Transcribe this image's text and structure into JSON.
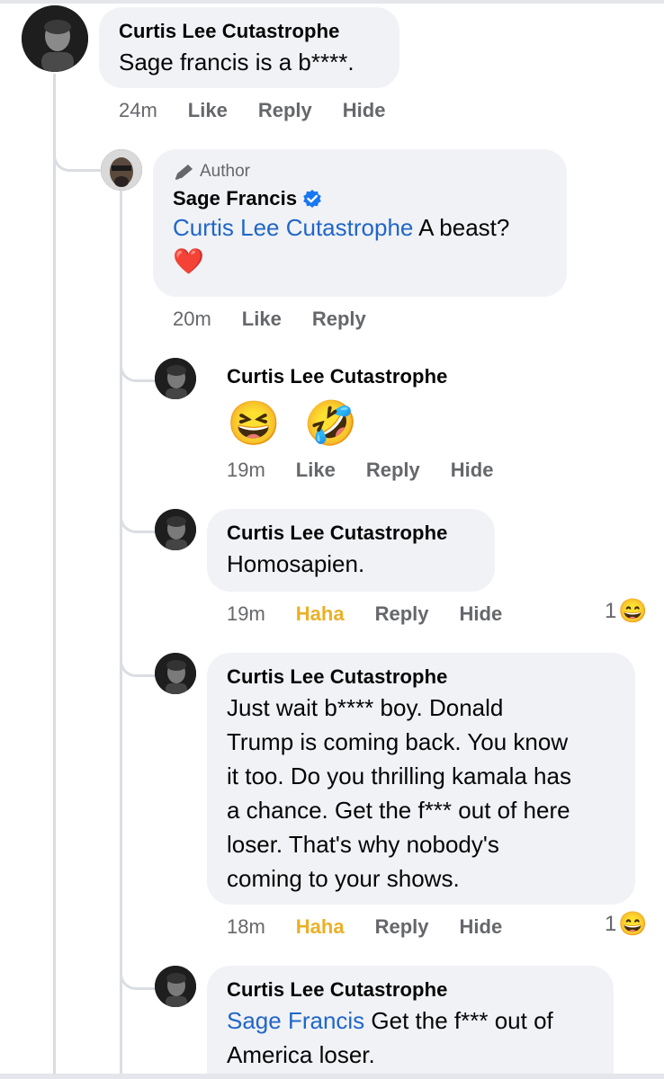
{
  "comments": [
    {
      "author": "Curtis Lee Cutastrophe",
      "text": "Sage francis is a b****.",
      "time": "24m",
      "actions": [
        "Like",
        "Reply",
        "Hide"
      ]
    },
    {
      "badge_label": "Author",
      "author": "Sage Francis",
      "verified": true,
      "mention": "Curtis Lee Cutastrophe",
      "text": " A beast?",
      "emoji": "❤️",
      "time": "20m",
      "actions": [
        "Like",
        "Reply"
      ]
    },
    {
      "author": "Curtis Lee Cutastrophe",
      "emojis": [
        "😆",
        "🤣"
      ],
      "time": "19m",
      "actions": [
        "Like",
        "Reply",
        "Hide"
      ]
    },
    {
      "author": "Curtis Lee Cutastrophe",
      "text": "Homosapien.",
      "time": "19m",
      "actions": [
        "Haha",
        "Reply",
        "Hide"
      ],
      "reaction_count": "1",
      "reaction_emoji": "😄"
    },
    {
      "author": "Curtis Lee Cutastrophe",
      "lines": [
        "Just wait b**** boy. Donald",
        "Trump is coming back. You know",
        "it too. Do you thrilling kamala has",
        "a chance. Get the f*** out of here",
        "loser. That's why nobody's",
        "coming to your shows."
      ],
      "time": "18m",
      "actions": [
        "Haha",
        "Reply",
        "Hide"
      ],
      "reaction_count": "1",
      "reaction_emoji": "😄"
    },
    {
      "author": "Curtis Lee Cutastrophe",
      "mention": "Sage Francis",
      "text_line1": " Get the f*** out of",
      "text_line2": "America loser."
    }
  ],
  "colors": {
    "bubble": "#f0f2f5",
    "mention": "#2166c9",
    "haha": "#eab026",
    "meta": "#65676b",
    "verified": "#1877f2"
  }
}
